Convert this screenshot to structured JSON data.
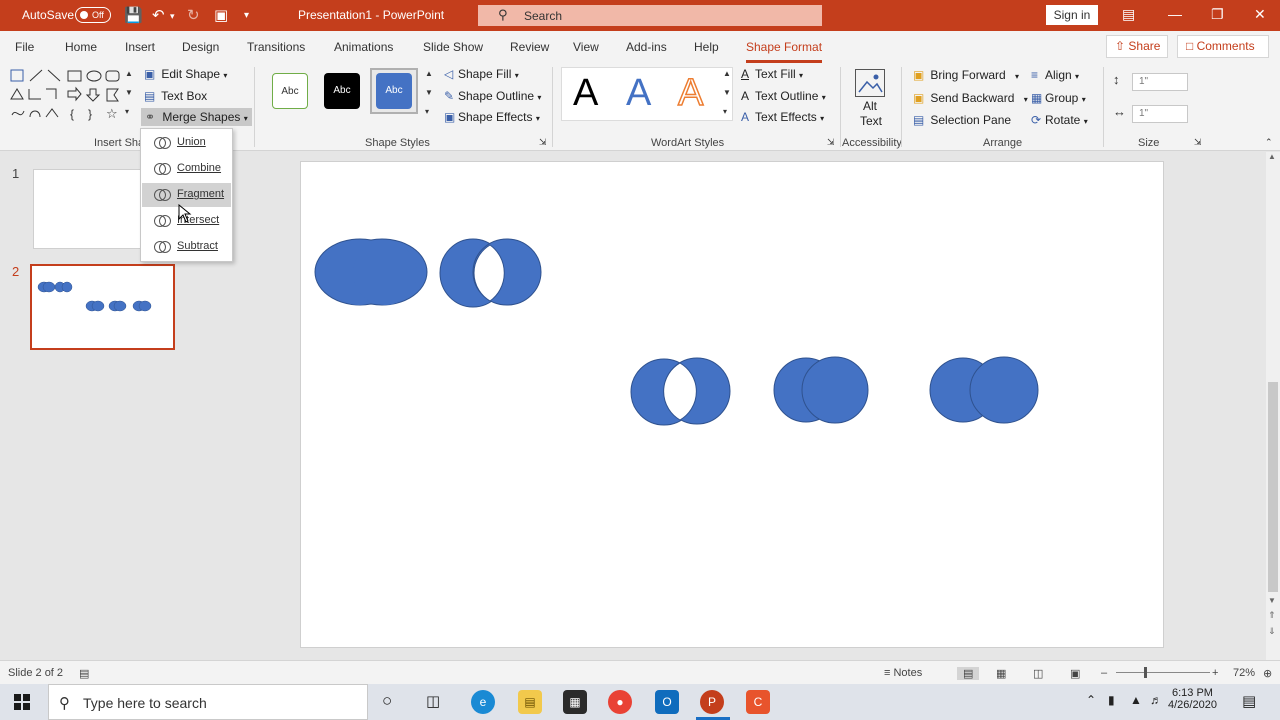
{
  "titlebar": {
    "autosave_label": "AutoSave",
    "autosave_state": "Off",
    "document_title": "Presentation1  -  PowerPoint",
    "search_placeholder": "Search",
    "signin_label": "Sign in"
  },
  "tabs": [
    "File",
    "Home",
    "Insert",
    "Design",
    "Transitions",
    "Animations",
    "Slide Show",
    "Review",
    "View",
    "Add-ins",
    "Help",
    "Shape Format"
  ],
  "active_tab": "Shape Format",
  "header_buttons": {
    "share": "Share",
    "comments": "Comments"
  },
  "ribbon": {
    "insert_shapes": {
      "edit_shape": "Edit Shape",
      "text_box": "Text Box",
      "merge_shapes": "Merge Shapes",
      "group_label": "Insert Sha"
    },
    "shape_styles": {
      "style1": "Abc",
      "style2": "Abc",
      "style3": "Abc",
      "shape_fill": "Shape Fill",
      "shape_outline": "Shape Outline",
      "shape_effects": "Shape Effects",
      "group_label": "Shape Styles"
    },
    "wordart": {
      "letter1": "A",
      "letter2": "A",
      "letter3": "A",
      "text_fill": "Text Fill",
      "text_outline": "Text Outline",
      "text_effects": "Text Effects",
      "group_label": "WordArt Styles"
    },
    "accessibility": {
      "alt_text_line1": "Alt",
      "alt_text_line2": "Text",
      "group_label": "Accessibility"
    },
    "arrange": {
      "bring_forward": "Bring Forward",
      "send_backward": "Send Backward",
      "selection_pane": "Selection Pane",
      "align": "Align",
      "group": "Group",
      "rotate": "Rotate",
      "group_label": "Arrange"
    },
    "size": {
      "height": "1\"",
      "width": "1\"",
      "group_label": "Size"
    }
  },
  "merge_menu": {
    "items": [
      "Union",
      "Combine",
      "Fragment",
      "Intersect",
      "Subtract"
    ],
    "highlighted": "Fragment"
  },
  "thumbnails": [
    {
      "number": "1"
    },
    {
      "number": "2"
    }
  ],
  "status": {
    "slide_info": "Slide 2 of 2",
    "notes": "Notes",
    "zoom": "72%"
  },
  "taskbar": {
    "search_placeholder": "Type here to search",
    "time": "6:13 PM",
    "date": "4/26/2020"
  },
  "colors": {
    "accent": "#c43e1c",
    "shape_fill": "#4472c4",
    "shape_outline": "#2f528f"
  }
}
